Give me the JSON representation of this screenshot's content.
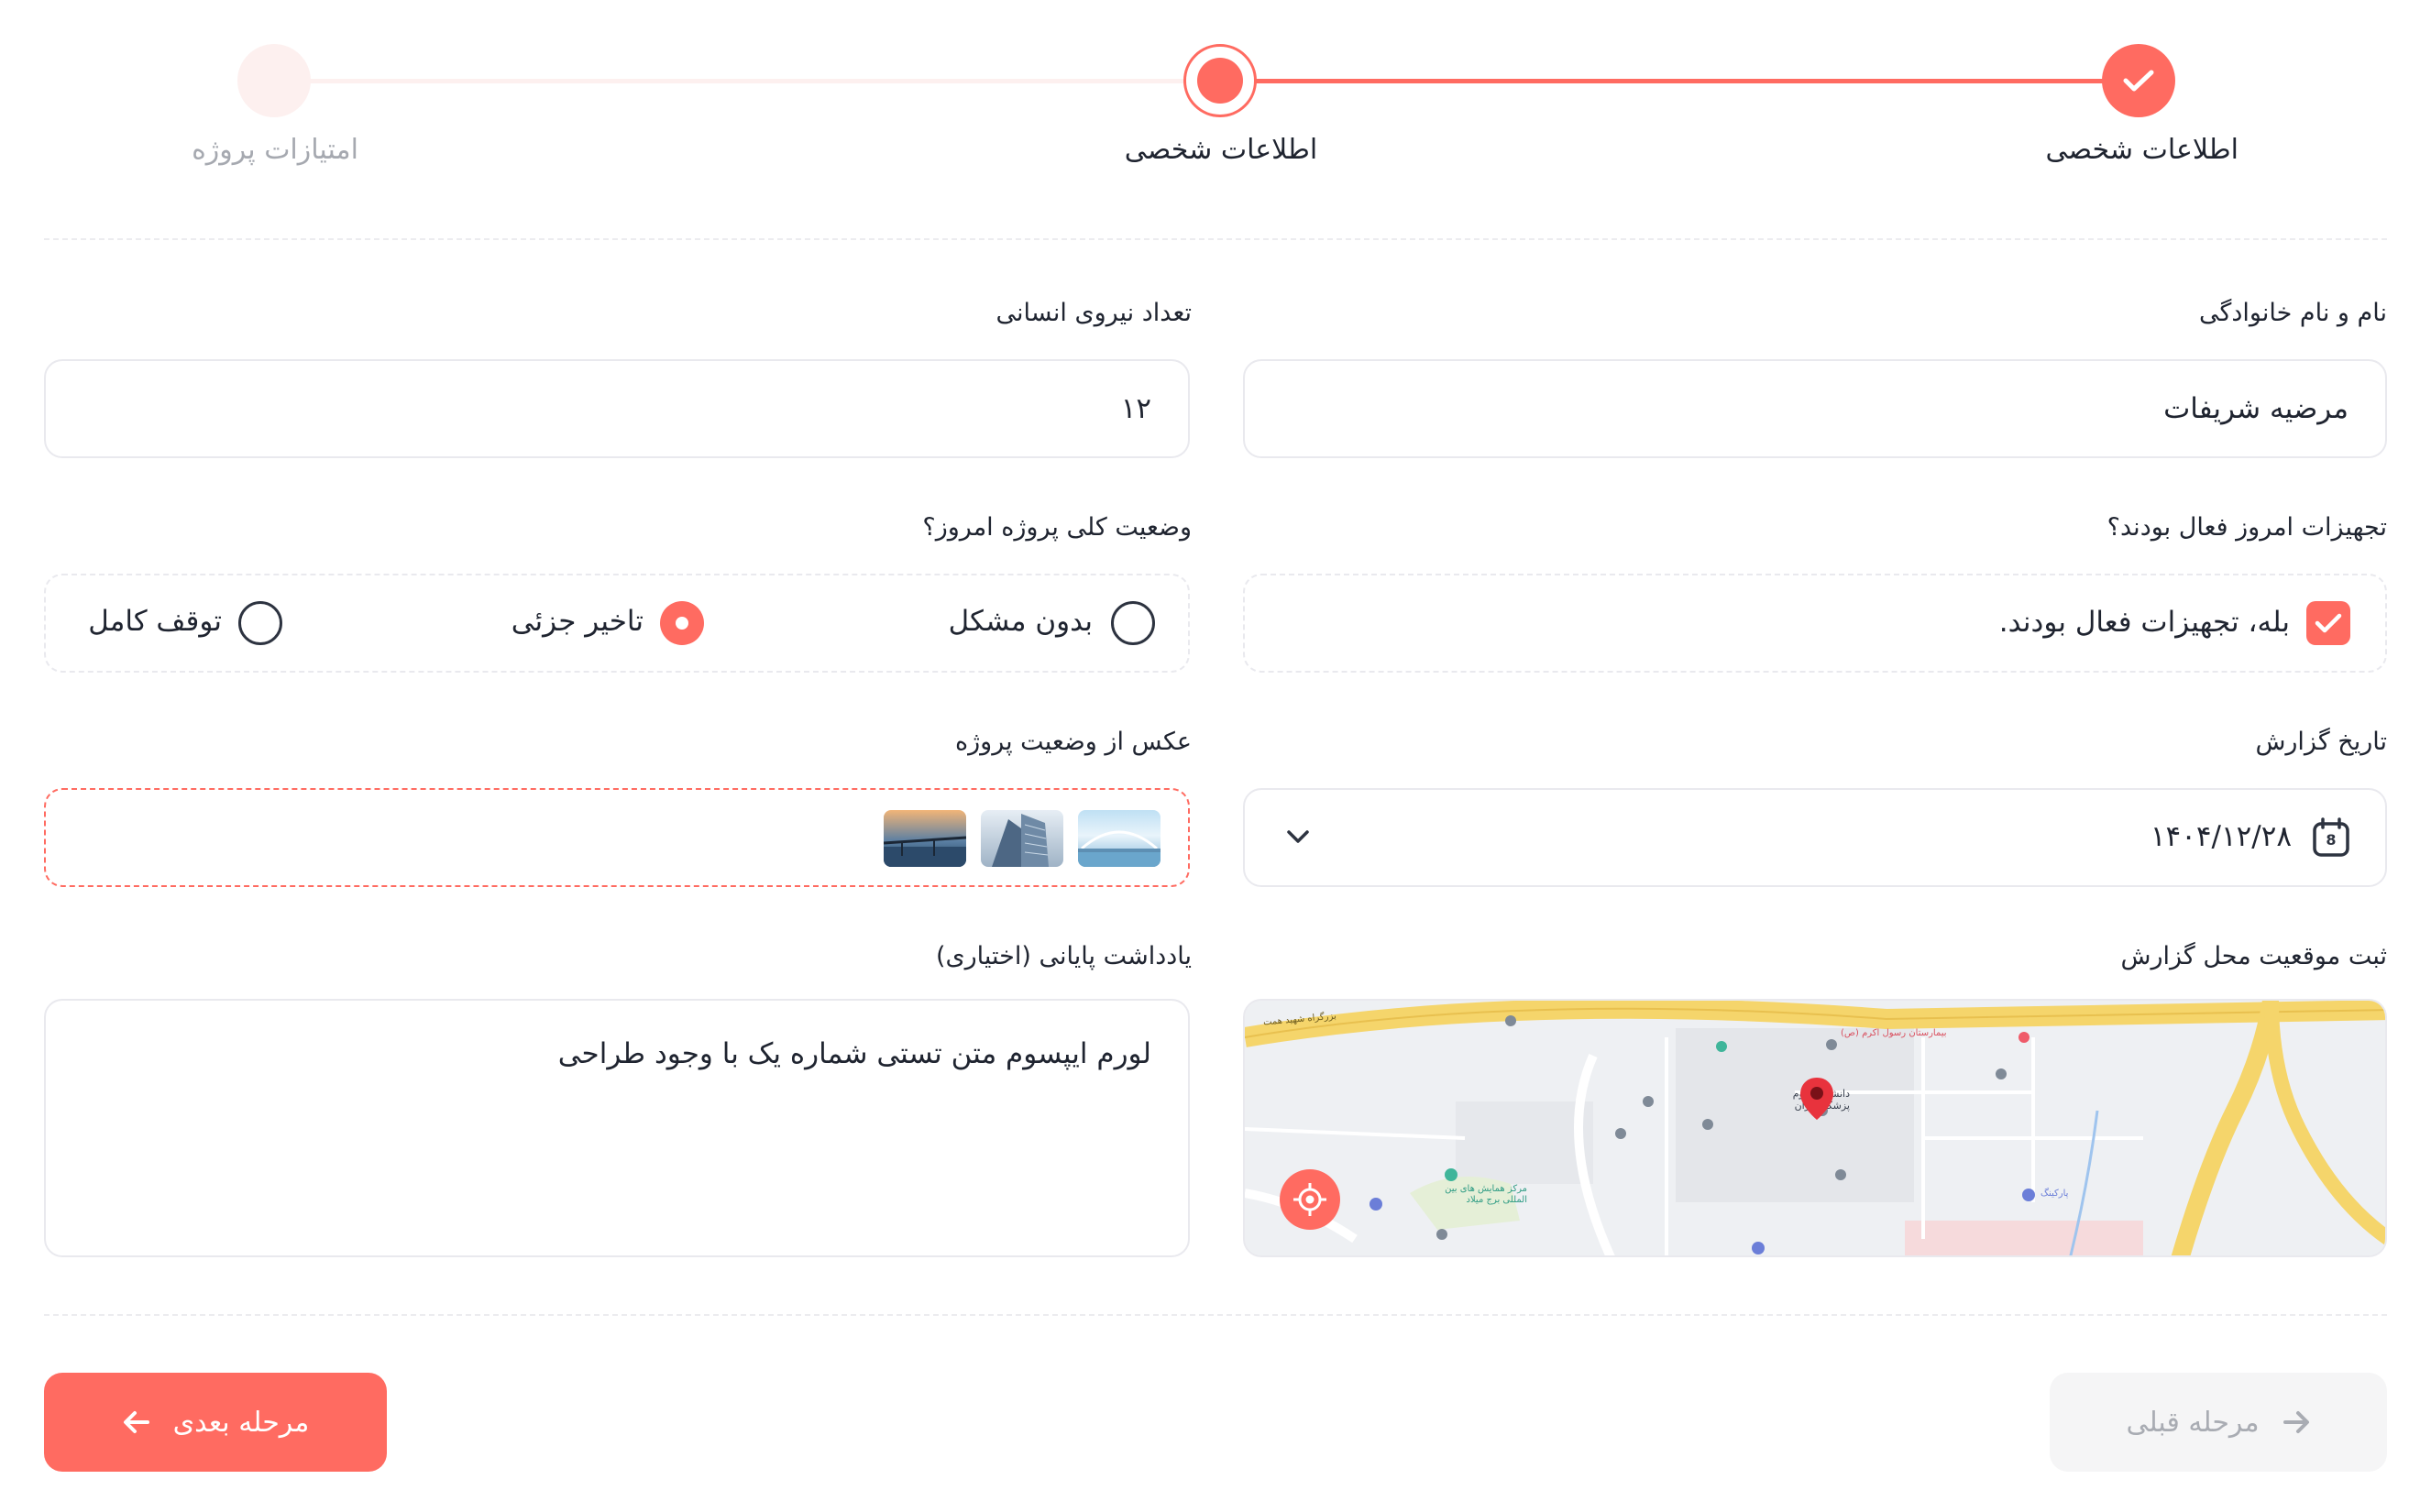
{
  "stepper": {
    "steps": [
      {
        "label": "اطلاعات شخصی",
        "state": "done"
      },
      {
        "label": "اطلاعات شخصی",
        "state": "active"
      },
      {
        "label": "امتیازات پروژه",
        "state": "todo"
      }
    ]
  },
  "form": {
    "full_name": {
      "label": "نام و نام خانوادگی",
      "value": "مرضیه شریفات"
    },
    "workforce": {
      "label": "تعداد نیروی انسانی",
      "value": "۱۲"
    },
    "equipment": {
      "label": "تجهیزات امروز فعال بودند؟",
      "option": "بله، تجهیزات فعال بودند.",
      "checked": true
    },
    "project_status": {
      "label": "وضعیت کلی پروژه امروز؟",
      "options": [
        "بدون مشکل",
        "تاخیر جزئی",
        "توقف کامل"
      ],
      "selected": "تاخیر جزئی"
    },
    "report_date": {
      "label": "تاریخ گزارش",
      "value": "۱۴۰۴/۱۲/۲۸",
      "calendar_day": "8"
    },
    "photos": {
      "label": "عکس از وضعیت پروژه"
    },
    "location": {
      "label": "ثبت موقعیت محل گزارش"
    },
    "notes": {
      "label": "یادداشت پایانی (اختیاری)",
      "value": "لورم ایپسوم متن تستی شماره یک با وجود طراحی"
    }
  },
  "map_labels": {
    "hospital": "بیمارستان رسول اکرم (ص)",
    "university": "دانشگاه علوم پزشکی ایران",
    "tower": "مرکز همایش های بین المللی برج میلاد",
    "highway": "بزرگراه شهید همت",
    "parking": "پارکینگ"
  },
  "buttons": {
    "next": "مرحله بعدی",
    "prev": "مرحله قبلی"
  },
  "colors": {
    "accent": "#ff6b61",
    "border": "#e9e9ee",
    "muted": "#a6a9b0"
  }
}
